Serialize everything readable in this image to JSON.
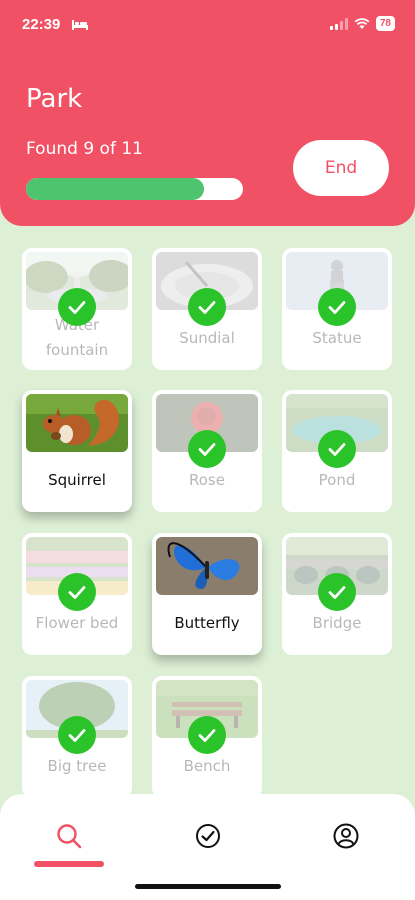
{
  "status_bar": {
    "time": "22:39",
    "battery": "78",
    "icons": [
      "bed-icon",
      "signal-icon",
      "wifi-icon",
      "battery-icon"
    ]
  },
  "header": {
    "title": "Park",
    "found_text": "Found 9 of 11",
    "progress_fraction": 0.818,
    "end_label": "End"
  },
  "colors": {
    "header": "#f15164",
    "background": "#ddf0d6",
    "progress": "#4fc46f",
    "check": "#2ac32a"
  },
  "items": [
    {
      "label": "Water fountain",
      "found": true
    },
    {
      "label": "Sundial",
      "found": true
    },
    {
      "label": "Statue",
      "found": true
    },
    {
      "label": "Squirrel",
      "found": false
    },
    {
      "label": "Rose",
      "found": true
    },
    {
      "label": "Pond",
      "found": true
    },
    {
      "label": "Flower bed",
      "found": true
    },
    {
      "label": "Butterfly",
      "found": false
    },
    {
      "label": "Bridge",
      "found": true
    },
    {
      "label": "Big tree",
      "found": true
    },
    {
      "label": "Bench",
      "found": true
    }
  ],
  "nav": {
    "items": [
      "search-icon",
      "check-circle-icon",
      "profile-icon"
    ],
    "active": "search-icon"
  }
}
